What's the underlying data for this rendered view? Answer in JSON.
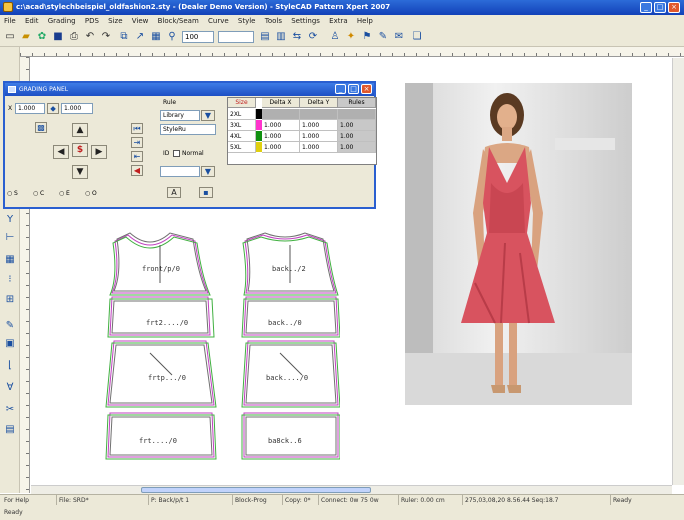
{
  "window": {
    "title": "c:\\acad\\stylechbeispiel_oldfashion2.sty - (Dealer Demo Version) - StyleCAD Pattern Xpert 2007"
  },
  "menu": [
    "File",
    "Edit",
    "Grading",
    "PDS",
    "Size",
    "View",
    "Block/Seam",
    "Curve",
    "Style",
    "Tools",
    "Settings",
    "Extra",
    "Help"
  ],
  "toolbar": {
    "zoom_value": "100",
    "size_value": "",
    "icons": [
      "new-icon",
      "open-icon",
      "save-icon",
      "print-icon",
      "undo-icon",
      "redo-icon",
      "copy-icon",
      "draw-icon",
      "grid-icon",
      "zoom-icon"
    ]
  },
  "grading_panel": {
    "title": "GRADING PANEL",
    "x_value": "1.000",
    "y_value": "1.000",
    "rule_label": "Rule",
    "rule_type": "Library",
    "rule_name": "StyleRu",
    "id_label": "ID",
    "normal_label": "Normal",
    "options": [
      "S",
      "C",
      "E",
      "O"
    ],
    "grid_headers": [
      "Size",
      "Delta X",
      "Delta Y",
      "Rules"
    ],
    "rows": [
      {
        "size": "2XL",
        "dx": "",
        "dy": "",
        "rule": "",
        "color": "#000000"
      },
      {
        "size": "3XL",
        "dx": "1.000",
        "dy": "1.000",
        "rule": "1.00",
        "color": "#ff33cc"
      },
      {
        "size": "4XL",
        "dx": "1.000",
        "dy": "1.000",
        "rule": "1.00",
        "color": "#109010"
      },
      {
        "size": "5XL",
        "dx": "1.000",
        "dy": "1.000",
        "rule": "1.00",
        "color": "#e0d010"
      }
    ]
  },
  "pieces": {
    "front_labels": [
      "front/p/0",
      "frt2..../0",
      "frtp.../0",
      "frt..../0"
    ],
    "back_labels": [
      "back../2",
      "back../0",
      "back..../0",
      "ba8ck..6"
    ]
  },
  "statusbar": {
    "cells": [
      "For Help",
      "File: SRD*",
      "P: Back/p/t 1",
      "Block-Prog",
      "Copy: 0*",
      "Connect: 0w 75 0w",
      "Ruler: 0.00 cm",
      "275,03,08,20  8.56.44  Seq:18.7",
      "Ready"
    ]
  },
  "bottom_text": "Ready"
}
